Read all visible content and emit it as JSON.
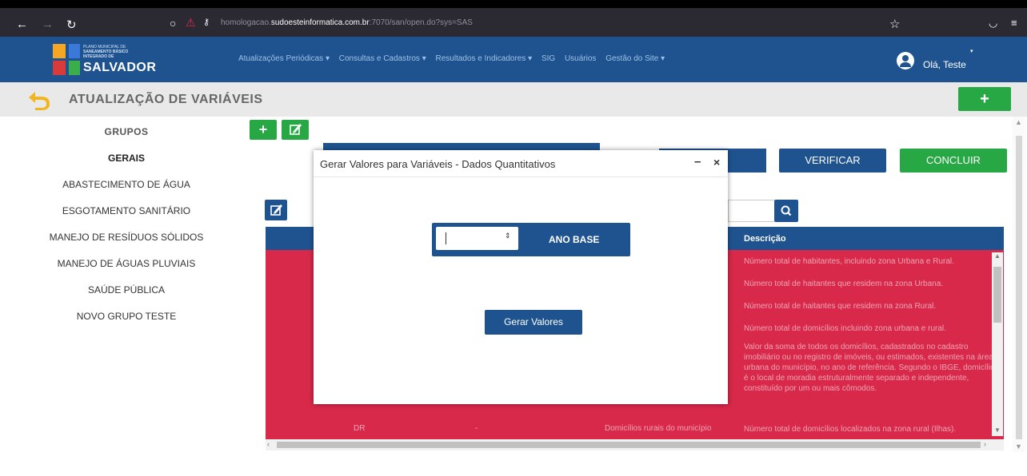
{
  "browser": {
    "url_prefix": "homologacao.",
    "url_domain": "sudoesteinformatica.com.br",
    "url_rest": ":7070/san/open.do?sys=SAS"
  },
  "logo": {
    "line1": "PLANO MUNICIPAL DE",
    "line2": "SANEAMENTO BÁSICO",
    "line3": "INTEGRADO DE",
    "line4": "SALVADOR"
  },
  "menu": [
    "Atualizações Periódicas ▾",
    "Consultas e Cadastros ▾",
    "Resultados e Indicadores ▾",
    "SIG",
    "Usuários",
    "Gestão do Site ▾"
  ],
  "user": {
    "greeting": "Olá, Teste"
  },
  "page": {
    "title": "ATUALIZAÇÃO DE VARIÁVEIS",
    "add_label": "+"
  },
  "sidebar": {
    "items": [
      {
        "label": "GRUPOS"
      },
      {
        "label": "GERAIS"
      },
      {
        "label": "ABASTECIMENTO DE ÁGUA"
      },
      {
        "label": "ESGOTAMENTO SANITÁRIO"
      },
      {
        "label": "MANEJO DE RESÍDUOS SÓLIDOS"
      },
      {
        "label": "MANEJO DE ÁGUAS PLUVIAIS"
      },
      {
        "label": "SAÚDE PÚBLICA"
      },
      {
        "label": "NOVO GRUPO TESTE"
      }
    ]
  },
  "toolbar": {
    "add": "+",
    "verify": "VERIFICAR",
    "conclude": "CONCLUIR"
  },
  "table": {
    "header_desc": "Descrição",
    "rows": [
      {
        "desc": "Número total de habitantes, incluindo zona Urbana e Rural."
      },
      {
        "desc": "Número total de haitantes que residem na zona Urbana."
      },
      {
        "desc": "Número total de haitantes que residem na zona Rural."
      },
      {
        "desc": "Número total de domicílios incluindo zona urbana e rural."
      },
      {
        "desc": "Valor da soma de todos os domicílios, cadastrados no cadastro imobiliário ou no registro de imóveis, ou estimados, existentes na área urbana do município, no ano de referência. Segundo o IBGE, domicílio é o local de moradia estruturalmente separado e independente, constituído por um ou mais cômodos."
      }
    ],
    "last_row": {
      "code": "DR",
      "value": "-",
      "name": "Domicílios rurais do município",
      "desc": "Número total de domicílios localizados na zona rural (Ilhas)."
    }
  },
  "modal": {
    "title": "Gerar Valores para Variáveis - Dados Quantitativos",
    "minimize": "–",
    "close": "×",
    "year_label": "ANO BASE",
    "year_value": "",
    "generate_button": "Gerar Valores"
  },
  "colors": {
    "brand_blue": "#1f5390",
    "green": "#28a745",
    "row_red": "#d8294a"
  }
}
